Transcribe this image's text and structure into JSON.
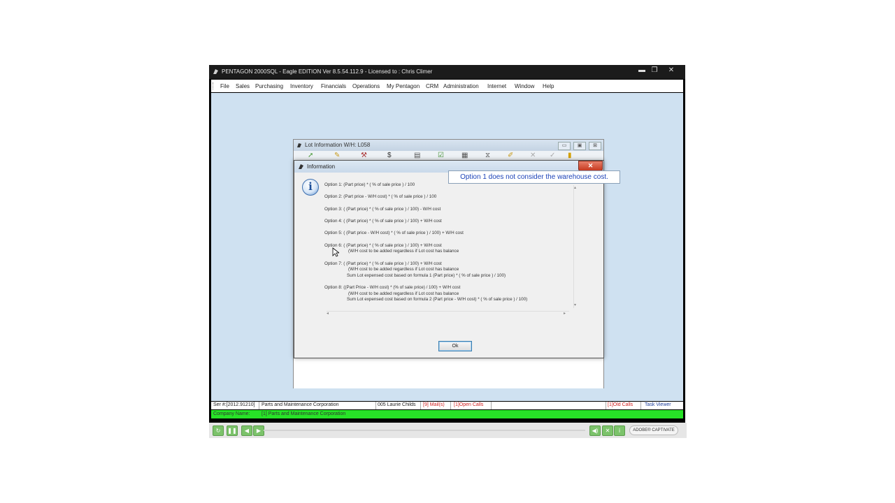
{
  "app": {
    "title": "PENTAGON 2000SQL - Eagle EDITION Ver 8.5.54.112.9 - Licensed to : Chris Climer",
    "window_buttons": {
      "minimize": "▬",
      "restore": "❐",
      "close": "✕"
    }
  },
  "menu": [
    "File",
    "Sales",
    "Purchasing",
    "Inventory",
    "Financials",
    "Operations",
    "My Pentagon",
    "CRM",
    "Administration",
    "Internet",
    "Window",
    "Help"
  ],
  "lot_window": {
    "title": "Lot Information   W/H: L058",
    "buttons": {
      "minimize": "▭",
      "restore": "▣",
      "close": "⊠"
    }
  },
  "info_dialog": {
    "title": "Information",
    "close_glyph": "✕",
    "icon": "information-icon",
    "options": [
      {
        "line": "Option 1: (Part price) * ( % of sale price ) / 100",
        "sub": []
      },
      {
        "line": "Option 2: (Part price - W/H cost) * ( % of sale price ) / 100",
        "sub": []
      },
      {
        "line": "Option 3: ( (Part price) * ( % of sale price ) / 100) - W/H cost",
        "sub": []
      },
      {
        "line": "Option 4: ( (Part price) * ( % of sale price ) / 100) + W/H cost",
        "sub": []
      },
      {
        "line": "Option 5: ( (Part price - W/H cost) * ( % of sale price ) / 100) + W/H cost",
        "sub": []
      },
      {
        "line": "Option 6: ( (Part price) * ( % of sale price ) / 100) + W/H cost",
        "sub": [
          "(W/H cost to be added regardless if Lot cost has balance"
        ]
      },
      {
        "line": "Option 7: ( (Part price) * ( % of sale price ) / 100) + W/H cost",
        "sub": [
          "(W/H cost to be added regardless if Lot cost has balance",
          "Sum Lot expensed cost based on formula 1 (Part price) * ( % of sale price ) / 100)"
        ]
      },
      {
        "line": "Option 8: ((Part Price - W/H cost) * (% of sale price) / 100) + W/H cost",
        "sub": [
          "(W/H cost to be added regardless if Lot cost has balance",
          "Sum Lot expensed cost based on formula 2 (Part price - W/H cost) * ( % of sale price ) / 100)"
        ]
      }
    ],
    "ok_label": "Ok"
  },
  "callout": "Option 1 does not consider the warehouse cost.",
  "status": {
    "ser": "Ser #:[2012.91210]",
    "company": "Parts and Maintenance Corporation",
    "user": "005 Laurie Childs",
    "mail": "[9] Mail(s)",
    "open_calls": "[1]Open Calls",
    "old_call": "[1]Old Calls",
    "task_viewer": "Task Viewer",
    "company_label": "Company Name:",
    "company_value": "[1]   Parts and Maintenance Corporation"
  },
  "playbar": {
    "brand": "ADOBE® CAPTIVATE",
    "colors": {
      "button": "#7cc36b"
    }
  },
  "colors": {
    "workspace": "#cfe1f1",
    "status_green": "#27e327",
    "callout_text": "#1d43b8",
    "status_red": "#d22020"
  }
}
